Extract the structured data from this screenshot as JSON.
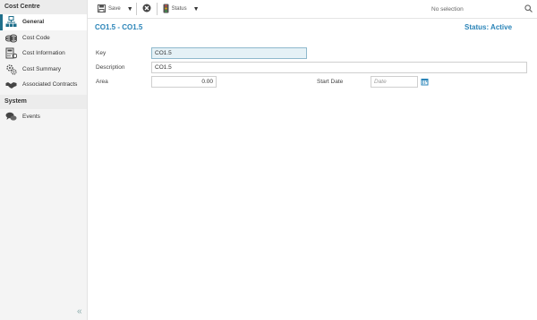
{
  "sidebar": {
    "cost_centre_header": "Cost Centre",
    "items": [
      {
        "label": "General",
        "icon": "org-chart-icon"
      },
      {
        "label": "Cost Code",
        "icon": "coins-icon"
      },
      {
        "label": "Cost Information",
        "icon": "calculator-icon"
      },
      {
        "label": "Cost Summary",
        "icon": "gears-icon"
      },
      {
        "label": "Associated Contracts",
        "icon": "handshake-icon"
      }
    ],
    "system_header": "System",
    "system_items": [
      {
        "label": "Events",
        "icon": "chat-bubbles-icon"
      }
    ],
    "collapse_icon": "double-chevron-left-icon"
  },
  "toolbar": {
    "save_label": "Save",
    "status_label": "Status",
    "selection_text": "No selection"
  },
  "header": {
    "title": "CO1.5 - CO1.5",
    "status": "Status: Active"
  },
  "form": {
    "key_label": "Key",
    "key_value": "CO1.5",
    "description_label": "Description",
    "description_value": "CO1.5",
    "area_label": "Area",
    "area_value": "0.00",
    "start_date_label": "Start Date",
    "start_date_placeholder": "Date"
  },
  "colors": {
    "accent": "#2a84b8",
    "active_border": "#1f6f8b",
    "sidebar_bg": "#f4f4f4"
  }
}
